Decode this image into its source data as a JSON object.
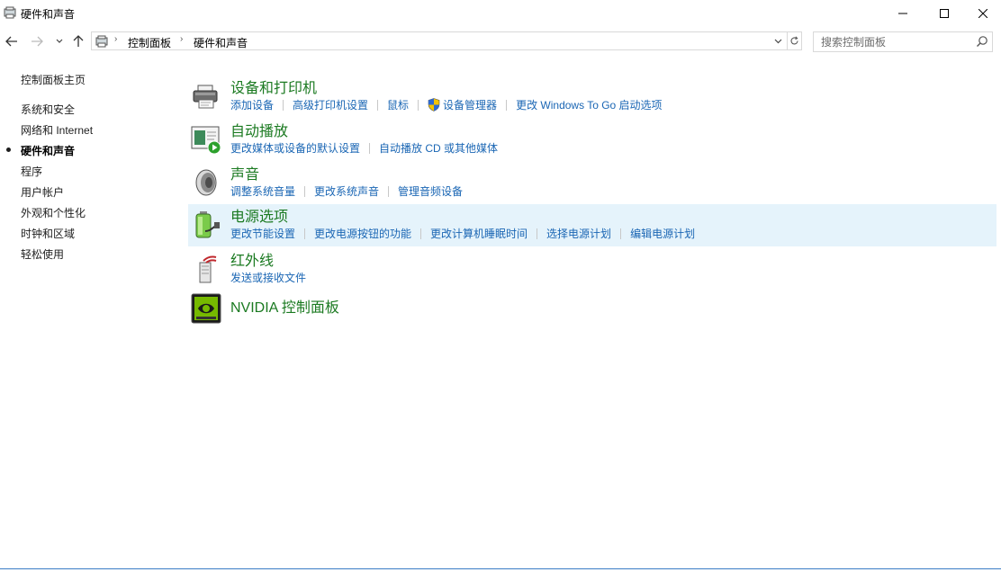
{
  "window": {
    "title": "硬件和声音",
    "title_icon": "control-panel-icon",
    "buttons": [
      "minimize-icon",
      "maximize-icon",
      "close-icon"
    ]
  },
  "nav": {
    "back_icon": "arrow-left-icon",
    "forward_icon": "arrow-right-icon",
    "recent_icon": "chevron-down-icon",
    "up_icon": "arrow-up-icon",
    "breadcrumb": [
      "控制面板",
      "硬件和声音"
    ],
    "refresh_icon": "refresh-icon"
  },
  "search": {
    "placeholder": "搜索控制面板",
    "value": ""
  },
  "sidebar": {
    "items": [
      {
        "label": "控制面板主页",
        "current": false
      },
      {
        "label": "系统和安全",
        "current": false
      },
      {
        "label": "网络和 Internet",
        "current": false
      },
      {
        "label": "硬件和声音",
        "current": true
      },
      {
        "label": "程序",
        "current": false
      },
      {
        "label": "用户帐户",
        "current": false
      },
      {
        "label": "外观和个性化",
        "current": false
      },
      {
        "label": "时钟和区域",
        "current": false
      },
      {
        "label": "轻松使用",
        "current": false
      }
    ]
  },
  "categories": [
    {
      "title": "设备和打印机",
      "icon": "printer-icon",
      "links": [
        "添加设备",
        "高级打印机设置",
        "鼠标",
        "设备管理器",
        "更改 Windows To Go 启动选项"
      ],
      "shield_on_link_index": 3
    },
    {
      "title": "自动播放",
      "icon": "autoplay-icon",
      "links": [
        "更改媒体或设备的默认设置",
        "自动播放 CD 或其他媒体"
      ]
    },
    {
      "title": "声音",
      "icon": "speaker-icon",
      "links": [
        "调整系统音量",
        "更改系统声音",
        "管理音频设备"
      ]
    },
    {
      "title": "电源选项",
      "icon": "battery-icon",
      "highlighted": true,
      "links": [
        "更改节能设置",
        "更改电源按钮的功能",
        "更改计算机睡眠时间",
        "选择电源计划",
        "编辑电源计划"
      ]
    },
    {
      "title": "红外线",
      "icon": "infrared-icon",
      "links": [
        "发送或接收文件"
      ]
    },
    {
      "title": "NVIDIA 控制面板",
      "icon": "nvidia-icon",
      "links": []
    }
  ],
  "colors": {
    "category_title": "#1b7a21",
    "link": "#1a66b4",
    "highlight": "#e5f3fb"
  }
}
